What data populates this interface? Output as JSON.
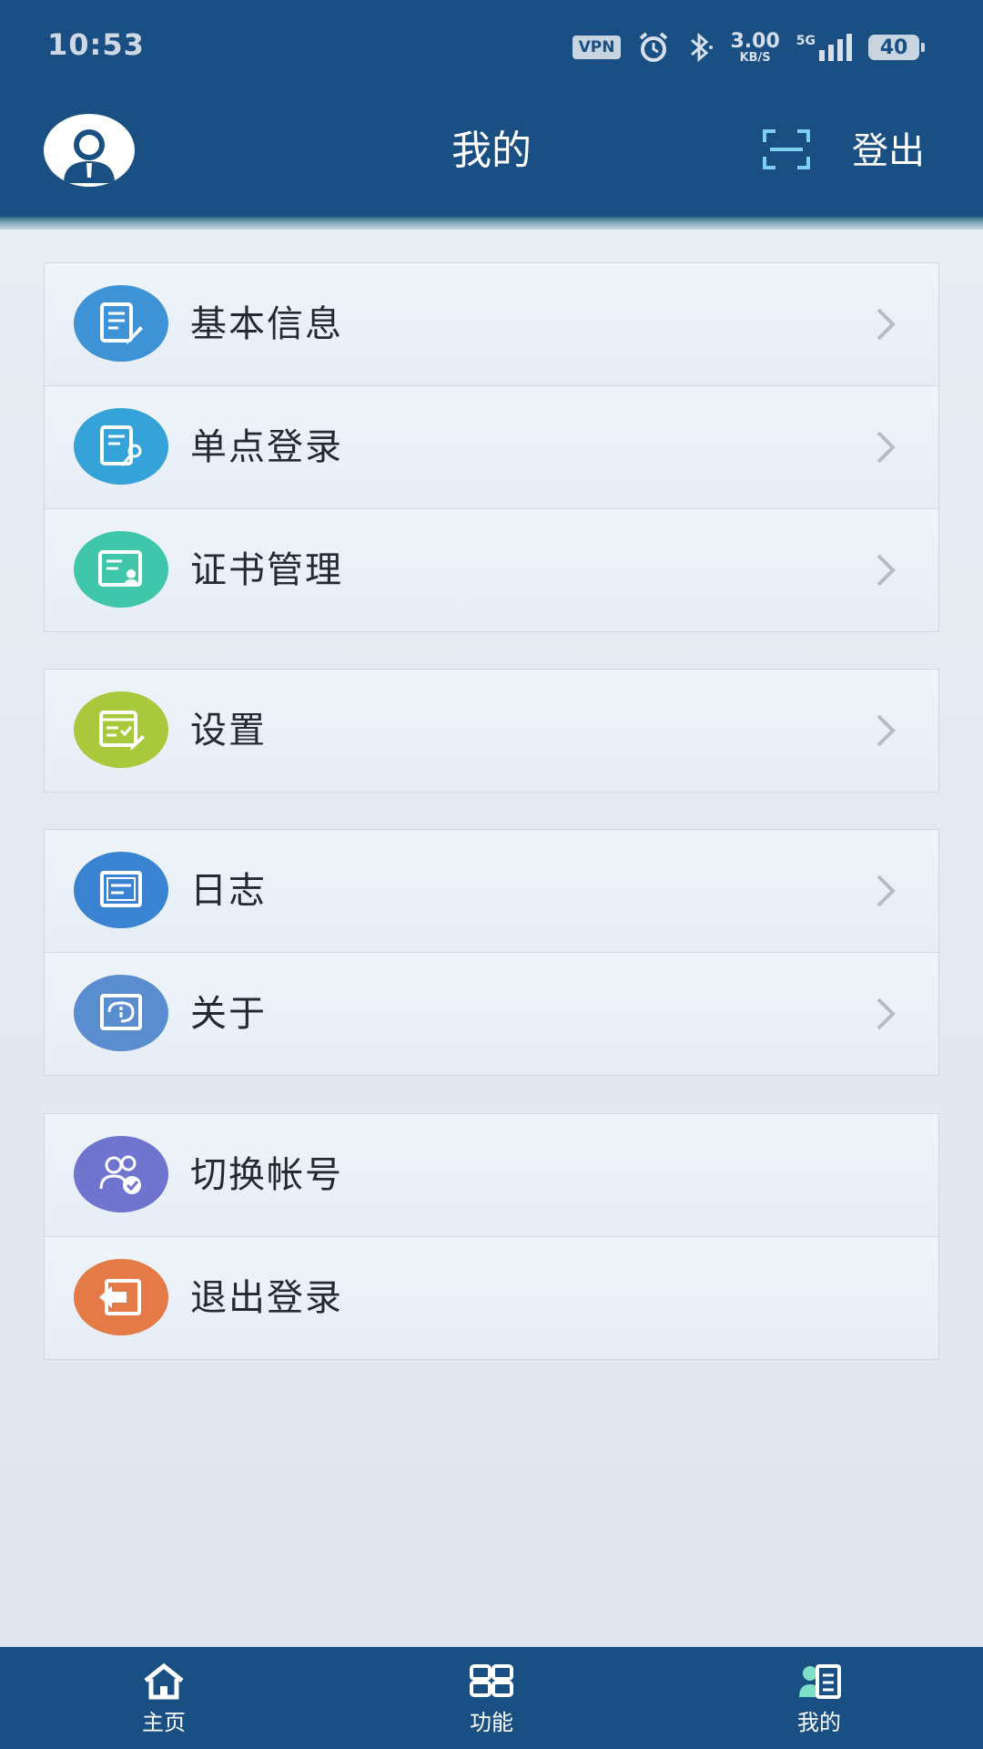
{
  "status_bar": {
    "time": "10:53",
    "vpn": "VPN",
    "net_speed_value": "3.00",
    "net_speed_unit": "KB/S",
    "network_type": "5G",
    "battery": "40"
  },
  "header": {
    "title": "我的",
    "logout_label": "登出",
    "accent_color": "#1a4f83"
  },
  "menu_groups": [
    {
      "items": [
        {
          "label": "基本信息",
          "icon": "profile-edit-icon",
          "color": "#3d93d6"
        },
        {
          "label": "单点登录",
          "icon": "document-key-icon",
          "color": "#36a3d8"
        },
        {
          "label": "证书管理",
          "icon": "certificate-icon",
          "color": "#3fc6ab"
        }
      ]
    },
    {
      "items": [
        {
          "label": "设置",
          "icon": "settings-check-icon",
          "color": "#a9c93c"
        }
      ]
    },
    {
      "items": [
        {
          "label": "日志",
          "icon": "log-icon",
          "color": "#3a83d2"
        },
        {
          "label": "关于",
          "icon": "info-icon",
          "color": "#5a8cd0"
        }
      ]
    },
    {
      "items": [
        {
          "label": "切换帐号",
          "icon": "switch-account-icon",
          "color": "#6f74cf"
        },
        {
          "label": "退出登录",
          "icon": "logout-arrow-icon",
          "color": "#e47a48"
        }
      ]
    }
  ],
  "bottom_nav": [
    {
      "label": "主页",
      "icon": "home-icon"
    },
    {
      "label": "功能",
      "icon": "apps-icon"
    },
    {
      "label": "我的",
      "icon": "profile-icon",
      "active": true
    }
  ]
}
